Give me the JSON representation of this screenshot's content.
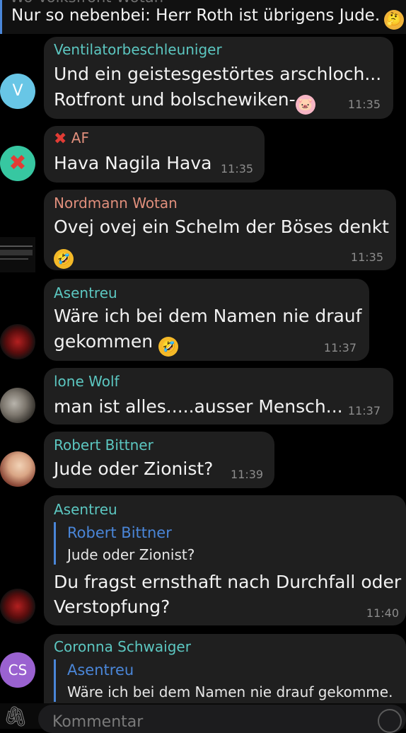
{
  "top": {
    "partial_name": "Wo Volksfront Wotan",
    "text": "Nur so nebenbei: Herr Roth ist übrigens Jude.",
    "emoji": "thinking-face"
  },
  "messages": [
    {
      "sender": "Ventilatorbeschleuniger",
      "lines": [
        "Und ein geistesgestörtes arschloch...",
        "Rotfront und bolschewiken-"
      ],
      "emoji": "pig-face",
      "time": "11:35",
      "avatar_letter": "V"
    },
    {
      "sender": "AF",
      "lines": [
        "Hava Nagila Hava"
      ],
      "time": "11:35"
    },
    {
      "sender": "Nordmann Wotan",
      "lines": [
        "Ovej ovej ein Schelm der Böses denkt"
      ],
      "emoji": "rofl-face",
      "time": "11:35"
    },
    {
      "sender": "Asentreu",
      "lines": [
        "Wäre ich bei dem Namen nie drauf",
        "gekommen"
      ],
      "emoji": "rofl-face",
      "time": "11:37"
    },
    {
      "sender": "lone Wolf",
      "lines": [
        "man ist alles.....ausser Mensch..."
      ],
      "time": "11:37"
    },
    {
      "sender": "Robert Bittner",
      "lines": [
        "Jude oder Zionist?"
      ],
      "time": "11:39"
    },
    {
      "sender": "Asentreu",
      "reply": {
        "name": "Robert Bittner",
        "text": "Jude oder Zionist?"
      },
      "lines": [
        "Du fragst ernsthaft nach Durchfall oder",
        "Verstopfung?"
      ],
      "time": "11:40"
    },
    {
      "sender": "Coronna Schwaiger",
      "reply": {
        "name": "Asentreu",
        "text": "Wäre ich bei dem Namen nie drauf gekomme."
      },
      "avatar_letter": "CS"
    }
  ],
  "composer": {
    "placeholder": "Kommentar"
  },
  "colors": {
    "teal": "#5cc7c1",
    "salmon": "#e08f7c",
    "blue": "#4a86d8",
    "bubble": "#1f1f1f"
  }
}
